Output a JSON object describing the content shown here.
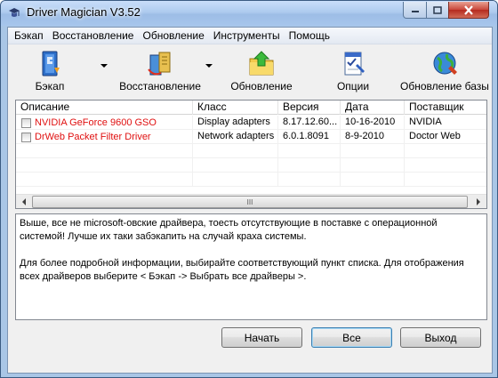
{
  "window": {
    "title": "Driver Magician V3.52"
  },
  "menu": [
    "Бэкап",
    "Восстановление",
    "Обновление",
    "Инструменты",
    "Помощь"
  ],
  "toolbar": {
    "backup": "Бэкап",
    "restore": "Восстановление",
    "update": "Обновление",
    "options": "Опции",
    "update_db": "Обновление базы"
  },
  "table": {
    "columns": [
      "Описание",
      "Класс",
      "Версия",
      "Дата",
      "Поставщик"
    ],
    "rows": [
      {
        "description": "NVIDIA GeForce 9600 GSO",
        "class": "Display adapters",
        "version": "8.17.12.60...",
        "date": "10-16-2010",
        "vendor": "NVIDIA",
        "checked": false
      },
      {
        "description": "DrWeb Packet Filter Driver",
        "class": "Network adapters",
        "version": "6.0.1.8091",
        "date": "8-9-2010",
        "vendor": "Doctor Web",
        "checked": false
      }
    ],
    "scroll_grip": "III"
  },
  "info": {
    "line1": "Выше, все не microsoft-овские драйвера, тоесть отсутствующие в поставке с операционной системой! Лучше их таки забэкапить на случай краха системы.",
    "line2": "Для более подробной информации, выбирайте соответствующий пункт списка. Для отображения всех драйверов выберите < Бэкап -> Выбрать все драйверы >."
  },
  "buttons": {
    "start": "Начать",
    "all": "Все",
    "exit": "Выход"
  },
  "colors": {
    "highlight_text": "#e01010",
    "titlebar": "#a9c6e6"
  }
}
